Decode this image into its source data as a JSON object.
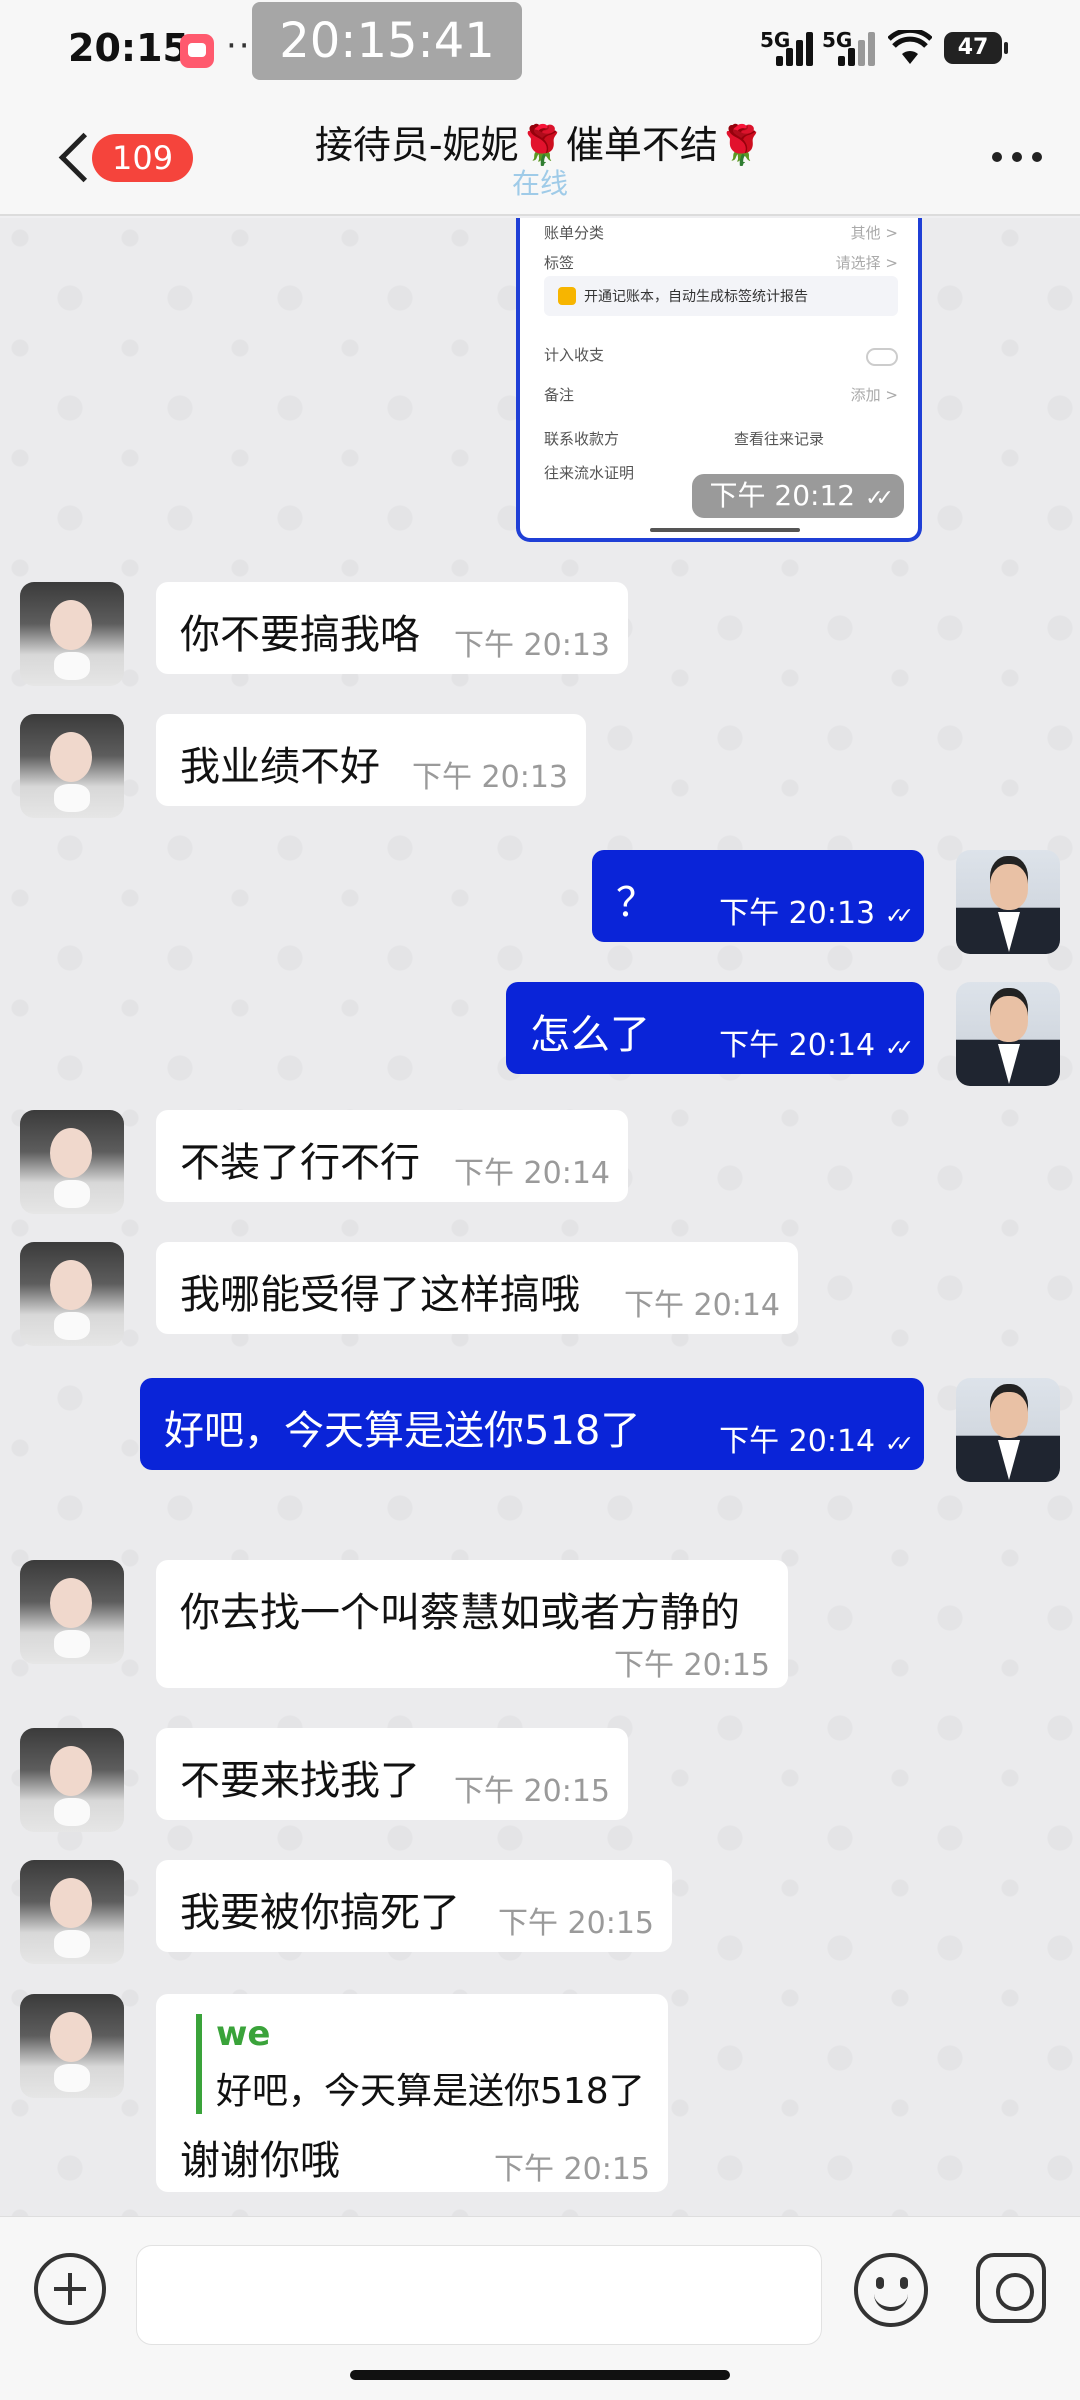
{
  "status_bar": {
    "time": "20:15",
    "notification_dots": "···",
    "clock_overlay": "20:15:41",
    "network_1": "5G",
    "network_2": "5G",
    "battery": "47"
  },
  "header": {
    "unread_count": "109",
    "title": "接待员-妮妮🌹催单不结🌹",
    "status": "在线"
  },
  "shared_screenshot": {
    "rows": [
      {
        "label": "账单分类",
        "value": "其他 >"
      },
      {
        "label": "标签",
        "value": "请选择 >"
      },
      {
        "label": "计入收支",
        "value": ""
      },
      {
        "label": "备注",
        "value": "添加 >"
      }
    ],
    "banner": "开通记账本，自动生成标签统计报告",
    "links": [
      "联系收款方",
      "查看往来记录",
      "往来流水证明"
    ],
    "time": "下午 20:12"
  },
  "messages": [
    {
      "side": "in",
      "text": "你不要搞我咯",
      "time": "下午 20:13"
    },
    {
      "side": "in",
      "text": "我业绩不好",
      "time": "下午 20:13"
    },
    {
      "side": "out",
      "text": "？",
      "time": "下午 20:13"
    },
    {
      "side": "out",
      "text": "怎么了",
      "time": "下午 20:14"
    },
    {
      "side": "in",
      "text": "不装了行不行",
      "time": "下午 20:14"
    },
    {
      "side": "in",
      "text": "我哪能受得了这样搞哦",
      "time": "下午 20:14"
    },
    {
      "side": "out",
      "text": "好吧，今天算是送你518了",
      "time": "下午 20:14"
    },
    {
      "side": "in",
      "text": "你去找一个叫蔡慧如或者方静的",
      "time": "下午 20:15"
    },
    {
      "side": "in",
      "text": "不要来找我了",
      "time": "下午 20:15"
    },
    {
      "side": "in",
      "text": "我要被你搞死了",
      "time": "下午 20:15"
    },
    {
      "side": "in",
      "quote_name": "we",
      "quote_text": "好吧，今天算是送你518了",
      "text": "谢谢你哦",
      "time": "下午 20:15"
    }
  ],
  "input": {
    "placeholder": ""
  },
  "icons": {
    "back": "chevron-left-icon",
    "more": "more-dots-icon",
    "attach": "plus-circle-icon",
    "emoji": "smiley-icon",
    "camera": "camera-icon"
  },
  "colors": {
    "outgoing_bubble": "#0a24d8",
    "incoming_bubble": "#ffffff",
    "badge": "#f5443c",
    "quote_accent": "#3aa33a"
  }
}
